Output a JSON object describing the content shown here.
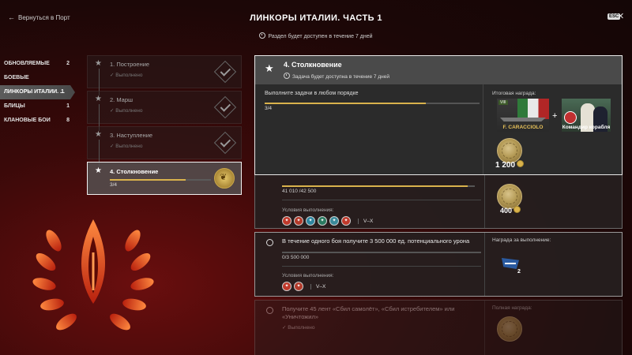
{
  "header": {
    "back_label": "Вернуться в Порт",
    "title": "ЛИНКОРЫ ИТАЛИИ. ЧАСТЬ 1",
    "subtitle": "Раздел будет доступен в течение 7 дней",
    "esc_label": "ESC",
    "close_glyph": "✕"
  },
  "categories": [
    {
      "label": "ОБНОВЛЯЕМЫЕ",
      "count": "2"
    },
    {
      "label": "БОЕВЫЕ",
      "count": ""
    },
    {
      "label": "ЛИНКОРЫ ИТАЛИИ. ...",
      "count": "1",
      "active": true
    },
    {
      "label": "БЛИЦЫ",
      "count": "1"
    },
    {
      "label": "КЛАНОВЫЕ БОИ",
      "count": "8"
    }
  ],
  "stages": [
    {
      "name": "1. Построение",
      "status": "Выполнено"
    },
    {
      "name": "2. Марш",
      "status": "Выполнено"
    },
    {
      "name": "3. Наступление",
      "status": "Выполнено"
    },
    {
      "name": "4. Столкновение",
      "progress_text": "3/4",
      "progress": 0.75
    }
  ],
  "task": {
    "title": "4. Столкновение",
    "subtitle": "Задача будет доступна в течение 7 дней",
    "condition": "Выполните задачи в любом порядке",
    "progress_text": "3/4",
    "progress": 0.75,
    "reward_label": "Итоговая награда:",
    "ship_name": "F. CARACCIOLO",
    "ship_badge": "VIII",
    "plus": "+",
    "commander_name": "Командир корабля",
    "coin_amount": "1 200"
  },
  "subtasks": [
    {
      "progress_text": "41 010 /42 500",
      "progress": 0.965,
      "conditions_label": "Условия выполнения:",
      "tier": "V–X",
      "nations": [
        "#c0392b",
        "#b33a2a",
        "#2e86a0",
        "#2a7a60",
        "#3a8a9a",
        "#c0392b"
      ],
      "coin_amount": "400"
    },
    {
      "description": "В течение одного боя получите 3 500 000 ед. потенциального урона",
      "progress_text": "0/3 500 000",
      "progress": 0.0,
      "conditions_label": "Условия выполнения:",
      "tier": "V–X",
      "nations": [
        "#c0392b",
        "#b33a2a"
      ],
      "reward_label": "Награда за выполнение:",
      "reward_count": "2"
    },
    {
      "description": "Получите 45 лент «Сбил самолёт», «Сбил истребителем» или «Уничтожил»",
      "status": "Выполнено",
      "reward_label": "Полная награда:"
    }
  ]
}
